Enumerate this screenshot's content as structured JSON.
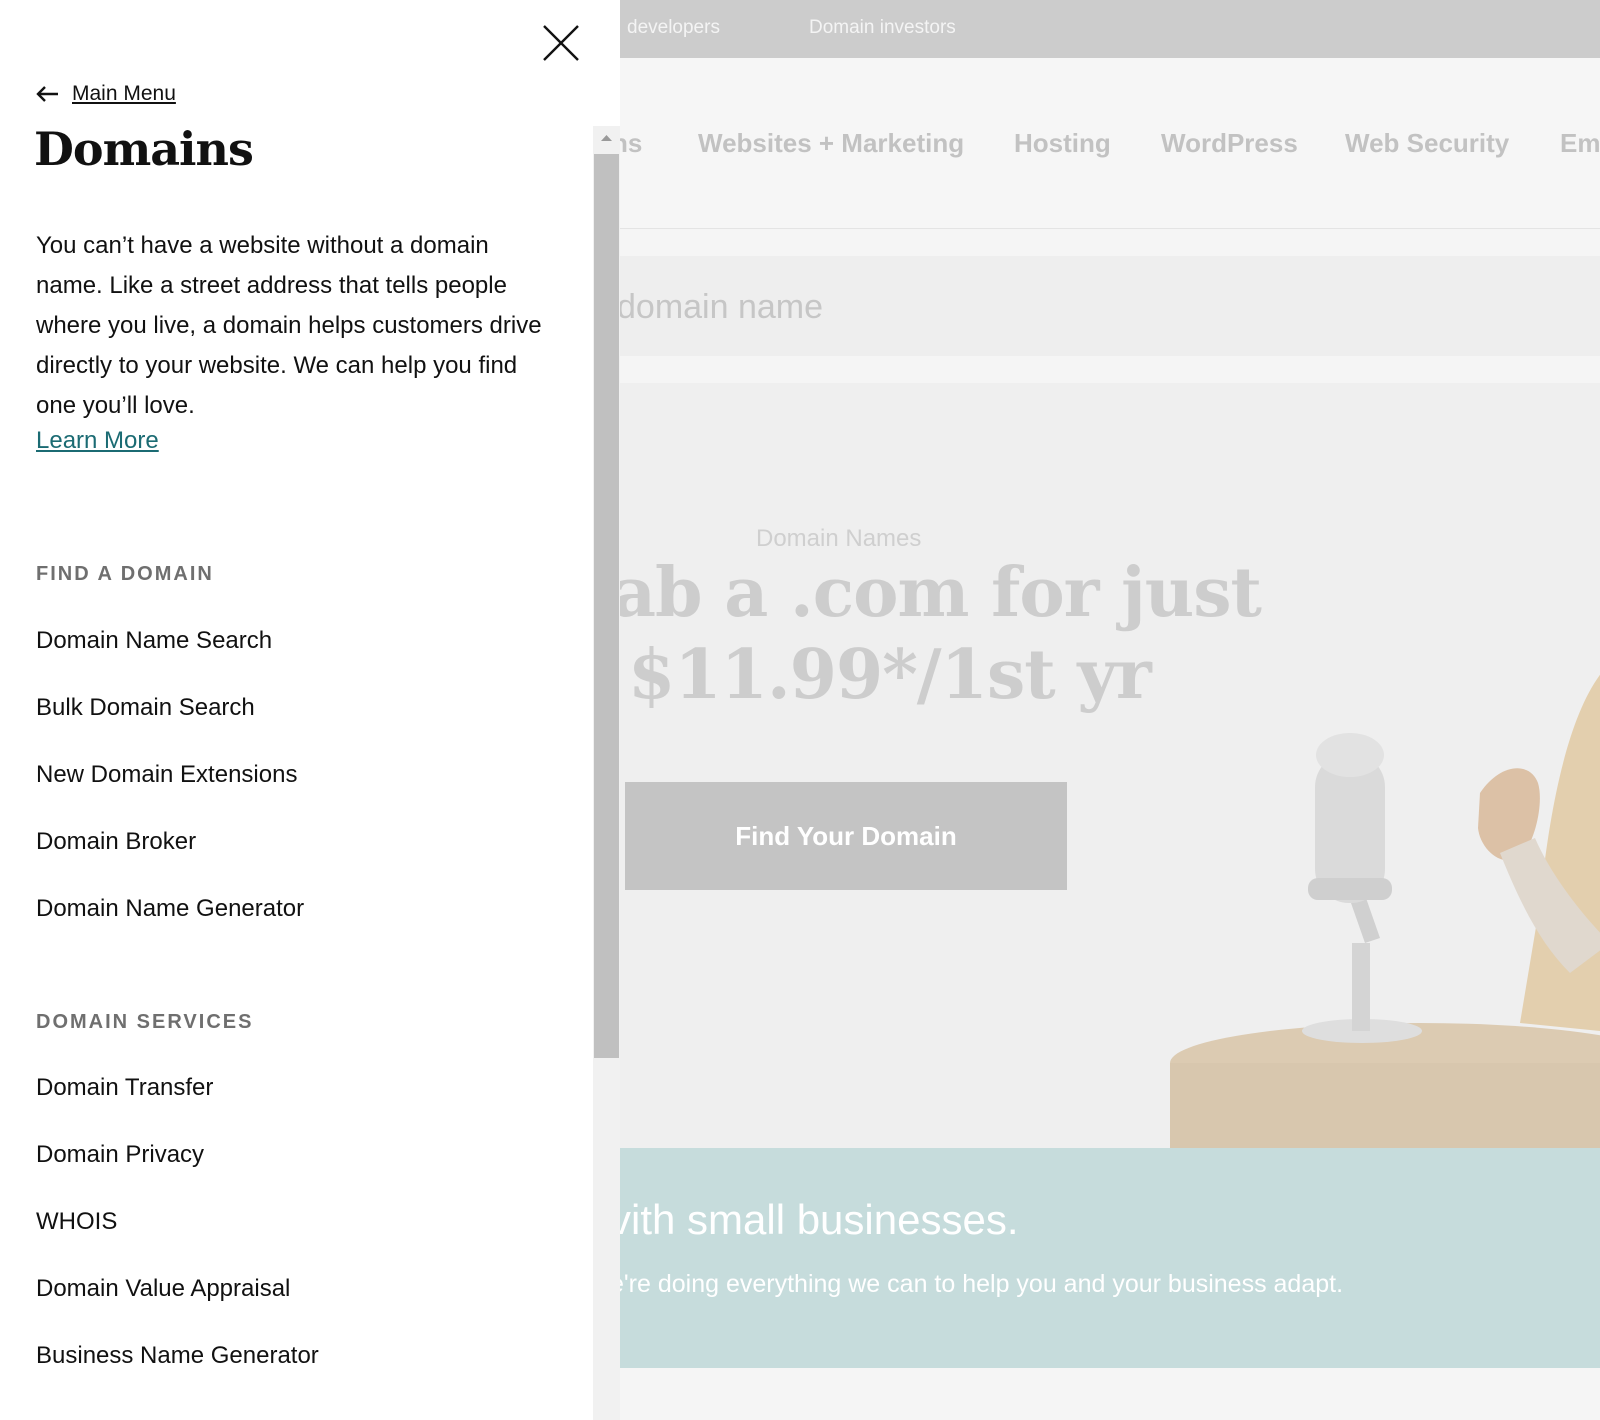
{
  "background": {
    "top_links": [
      "developers",
      "Domain investors"
    ],
    "nav": [
      "ns",
      "Websites + Marketing",
      "Hosting",
      "WordPress",
      "Web Security",
      "Ema"
    ],
    "search_placeholder": "domain name",
    "hero": {
      "kicker": "Domain Names",
      "line1": "ab a .com for just",
      "line2": "$11.99*/1st yr",
      "button": "Find Your Domain"
    },
    "banner": {
      "title": "vith small businesses.",
      "subtitle": "e're doing everything we can to help you and your business adapt."
    }
  },
  "panel": {
    "back_label": "Main Menu",
    "title": "Domains",
    "description": "You can’t have a website without a domain name. Like a street address that tells people where you live, a domain helps customers drive directly to your website. We can help you find one you’ll love.",
    "learn_more": "Learn More",
    "sections": [
      {
        "heading": "Find a Domain",
        "items": [
          "Domain Name Search",
          "Bulk Domain Search",
          "New Domain Extensions",
          "Domain Broker",
          "Domain Name Generator"
        ]
      },
      {
        "heading": "Domain Services",
        "items": [
          "Domain Transfer",
          "Domain Privacy",
          "WHOIS",
          "Domain Value Appraisal",
          "Business Name Generator"
        ]
      }
    ]
  },
  "icons": {
    "close": "close-icon",
    "back": "arrow-left-icon",
    "scroll_up": "scroll-up-arrow-icon"
  },
  "colors": {
    "link": "#1b6b73",
    "banner": "#c6dcdc",
    "overlay_button": "#c4c4c4"
  }
}
